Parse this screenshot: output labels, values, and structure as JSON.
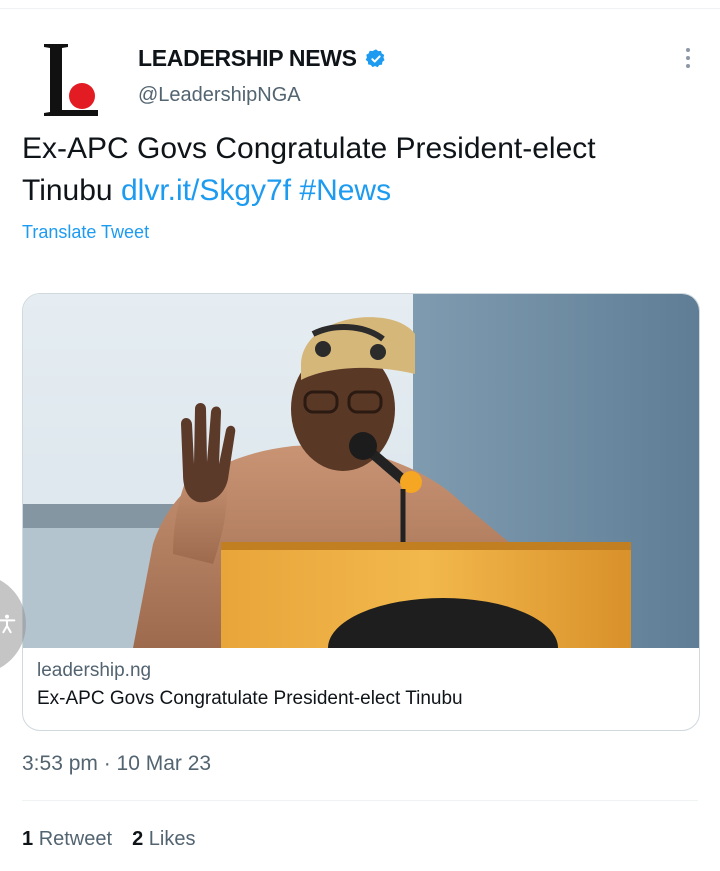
{
  "account": {
    "display_name": "LEADERSHIP NEWS",
    "handle": "@LeadershipNGA",
    "verified": true,
    "avatar_letter": "L",
    "brand_red": "#e31b23"
  },
  "tweet": {
    "text": "Ex-APC Govs Congratulate President-elect Tinubu",
    "link": "dlvr.it/Skgy7f",
    "hashtag": "#News",
    "translate_label": "Translate Tweet",
    "timestamp": "3:53 pm · 10 Mar 23"
  },
  "card": {
    "domain": "leadership.ng",
    "title": "Ex-APC Govs Congratulate President-elect Tinubu",
    "image_icon": "photo-of-speaker-at-podium"
  },
  "stats": {
    "retweets_count": "1",
    "retweets_label": "Retweet",
    "likes_count": "2",
    "likes_label": "Likes"
  },
  "icons": {
    "more": "more-vertical-icon",
    "verified": "verified-badge-icon",
    "accessibility": "accessibility-icon"
  },
  "colors": {
    "link": "#1d9bf0",
    "secondary_text": "#536471",
    "verified": "#1d9bf0"
  }
}
